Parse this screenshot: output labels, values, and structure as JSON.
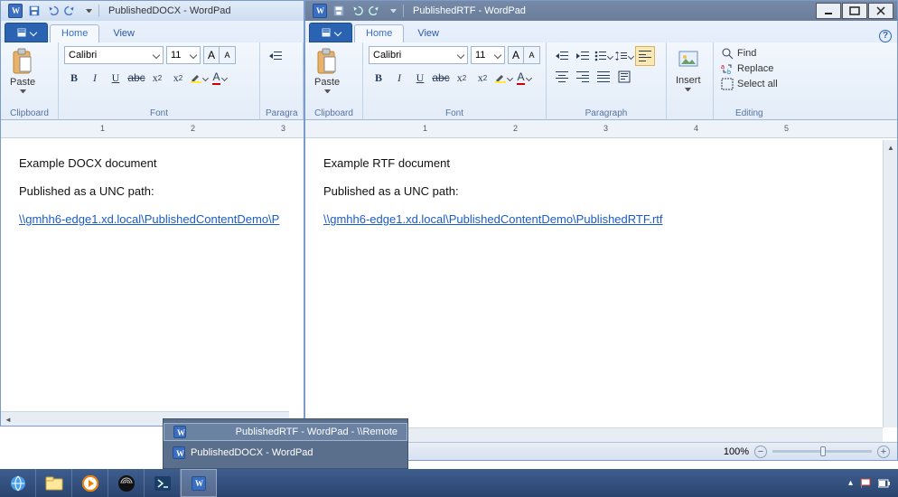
{
  "windows": {
    "left": {
      "title": "PublishedDOCX - WordPad",
      "tabs": {
        "home": "Home",
        "view": "View"
      },
      "ribbon": {
        "clipboard_label": "Clipboard",
        "paste": "Paste",
        "font_label": "Font",
        "font_name": "Calibri",
        "font_size": "11",
        "grow_font": "A",
        "shrink_font": "A",
        "paragraph_trunc": "Paragra"
      },
      "document": {
        "line1": "Example DOCX document",
        "line2": "Published as a UNC path:",
        "link": "\\\\gmhh6-edge1.xd.local\\PublishedContentDemo\\P"
      }
    },
    "right": {
      "title": "PublishedRTF - WordPad",
      "tabs": {
        "home": "Home",
        "view": "View"
      },
      "ribbon": {
        "clipboard_label": "Clipboard",
        "paste": "Paste",
        "font_label": "Font",
        "font_name": "Calibri",
        "font_size": "11",
        "paragraph_label": "Paragraph",
        "insert_label": "Insert",
        "editing_label": "Editing",
        "find": "Find",
        "replace": "Replace",
        "selectall": "Select all"
      },
      "document": {
        "line1": "Example RTF document",
        "line2": "Published as a UNC path:",
        "link": "\\\\gmhh6-edge1.xd.local\\PublishedContentDemo\\PublishedRTF.rtf"
      },
      "status": {
        "zoom": "100%"
      }
    }
  },
  "switcher": {
    "items": [
      "PublishedRTF - WordPad - \\\\Remote",
      "PublishedDOCX - WordPad"
    ]
  },
  "ruler_numbers": [
    "1",
    "2",
    "3",
    "4",
    "5"
  ]
}
